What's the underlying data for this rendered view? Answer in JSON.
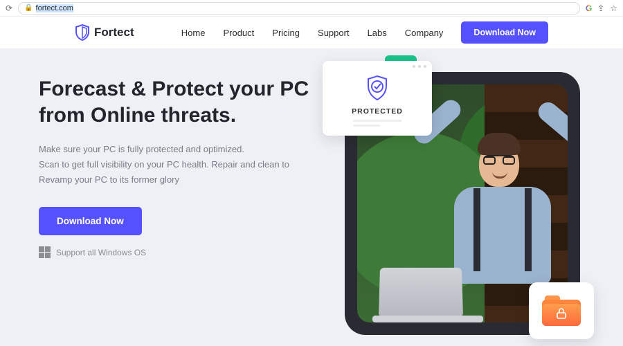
{
  "browser": {
    "url_host": "fortect.com",
    "selected": true
  },
  "brand": "Fortect",
  "nav": {
    "items": [
      {
        "label": "Home"
      },
      {
        "label": "Product"
      },
      {
        "label": "Pricing"
      },
      {
        "label": "Support"
      },
      {
        "label": "Labs"
      },
      {
        "label": "Company"
      }
    ],
    "cta": "Download Now"
  },
  "hero": {
    "headline_l1": "Forecast & Protect your PC",
    "headline_l2": "from Online threats.",
    "sub_l1": "Make sure your PC is fully protected and optimized.",
    "sub_l2": "Scan to get full visibility on your PC health. Repair and clean to",
    "sub_l3": "Revamp your PC to its former glory",
    "cta": "Download Now",
    "support_text": "Support all Windows OS"
  },
  "popup": {
    "label": "PROTECTED"
  },
  "colors": {
    "primary": "#5551ff",
    "folder_start": "#ff9e4d",
    "folder_end": "#ff5a3d",
    "green_accent": "#18c48a"
  }
}
